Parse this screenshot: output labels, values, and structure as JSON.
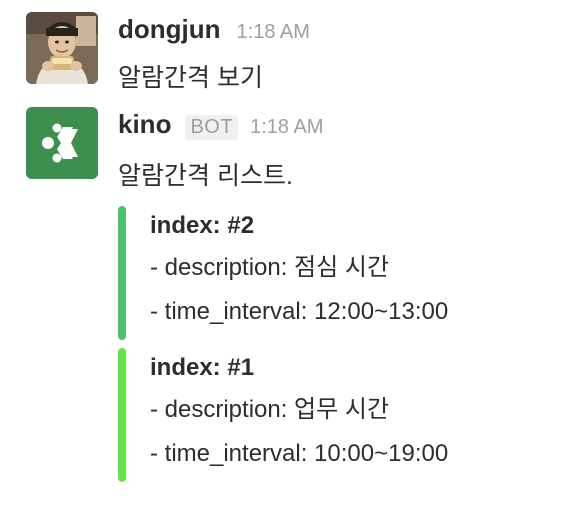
{
  "messages": [
    {
      "sender": "dongjun",
      "timestamp": "1:18 AM",
      "text": "알람간격 보기"
    },
    {
      "sender": "kino",
      "badge": "BOT",
      "timestamp": "1:18 AM",
      "text": "알람간격 리스트.",
      "attachments": [
        {
          "color": "#4cc16a",
          "title": "index: #2",
          "lines": [
            "- description: 점심 시간",
            "- time_interval: 12:00~13:00"
          ]
        },
        {
          "color": "#64e64a",
          "title": "index: #1",
          "lines": [
            "- description: 업무 시간",
            "- time_interval: 10:00~19:00"
          ]
        }
      ]
    }
  ],
  "icons": {
    "user_avatar": "user-photo-avatar",
    "bot_avatar": "kino-bot-logo"
  }
}
